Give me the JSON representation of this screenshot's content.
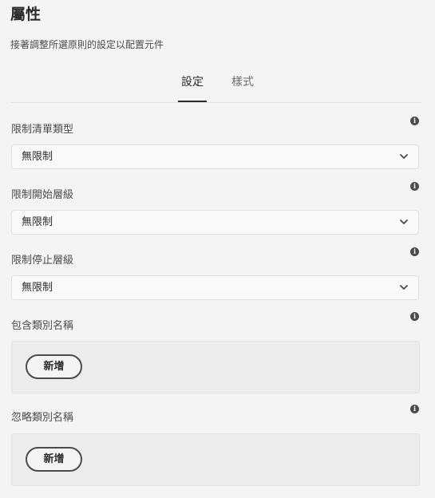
{
  "header": {
    "title": "屬性",
    "description": "接著調整所選原則的設定以配置元件"
  },
  "tabs": [
    {
      "label": "設定",
      "active": true
    },
    {
      "label": "樣式",
      "active": false
    }
  ],
  "fields": {
    "list_type": {
      "label": "限制清單類型",
      "value": "無限制"
    },
    "start_level": {
      "label": "限制開始層級",
      "value": "無限制"
    },
    "stop_level": {
      "label": "限制停止層級",
      "value": "無限制"
    },
    "include_names": {
      "label": "包含類別名稱",
      "add_label": "新增"
    },
    "ignore_names": {
      "label": "忽略類別名稱",
      "add_label": "新增"
    }
  },
  "icons": {
    "info": "info-icon",
    "dropdown": "chevron-down-icon"
  },
  "colors": {
    "background": "#f4f4f4",
    "text": "#2c2c2c",
    "field_bg": "#fafafa",
    "multifield_bg": "#ececec",
    "border": "#e1e1e1"
  }
}
